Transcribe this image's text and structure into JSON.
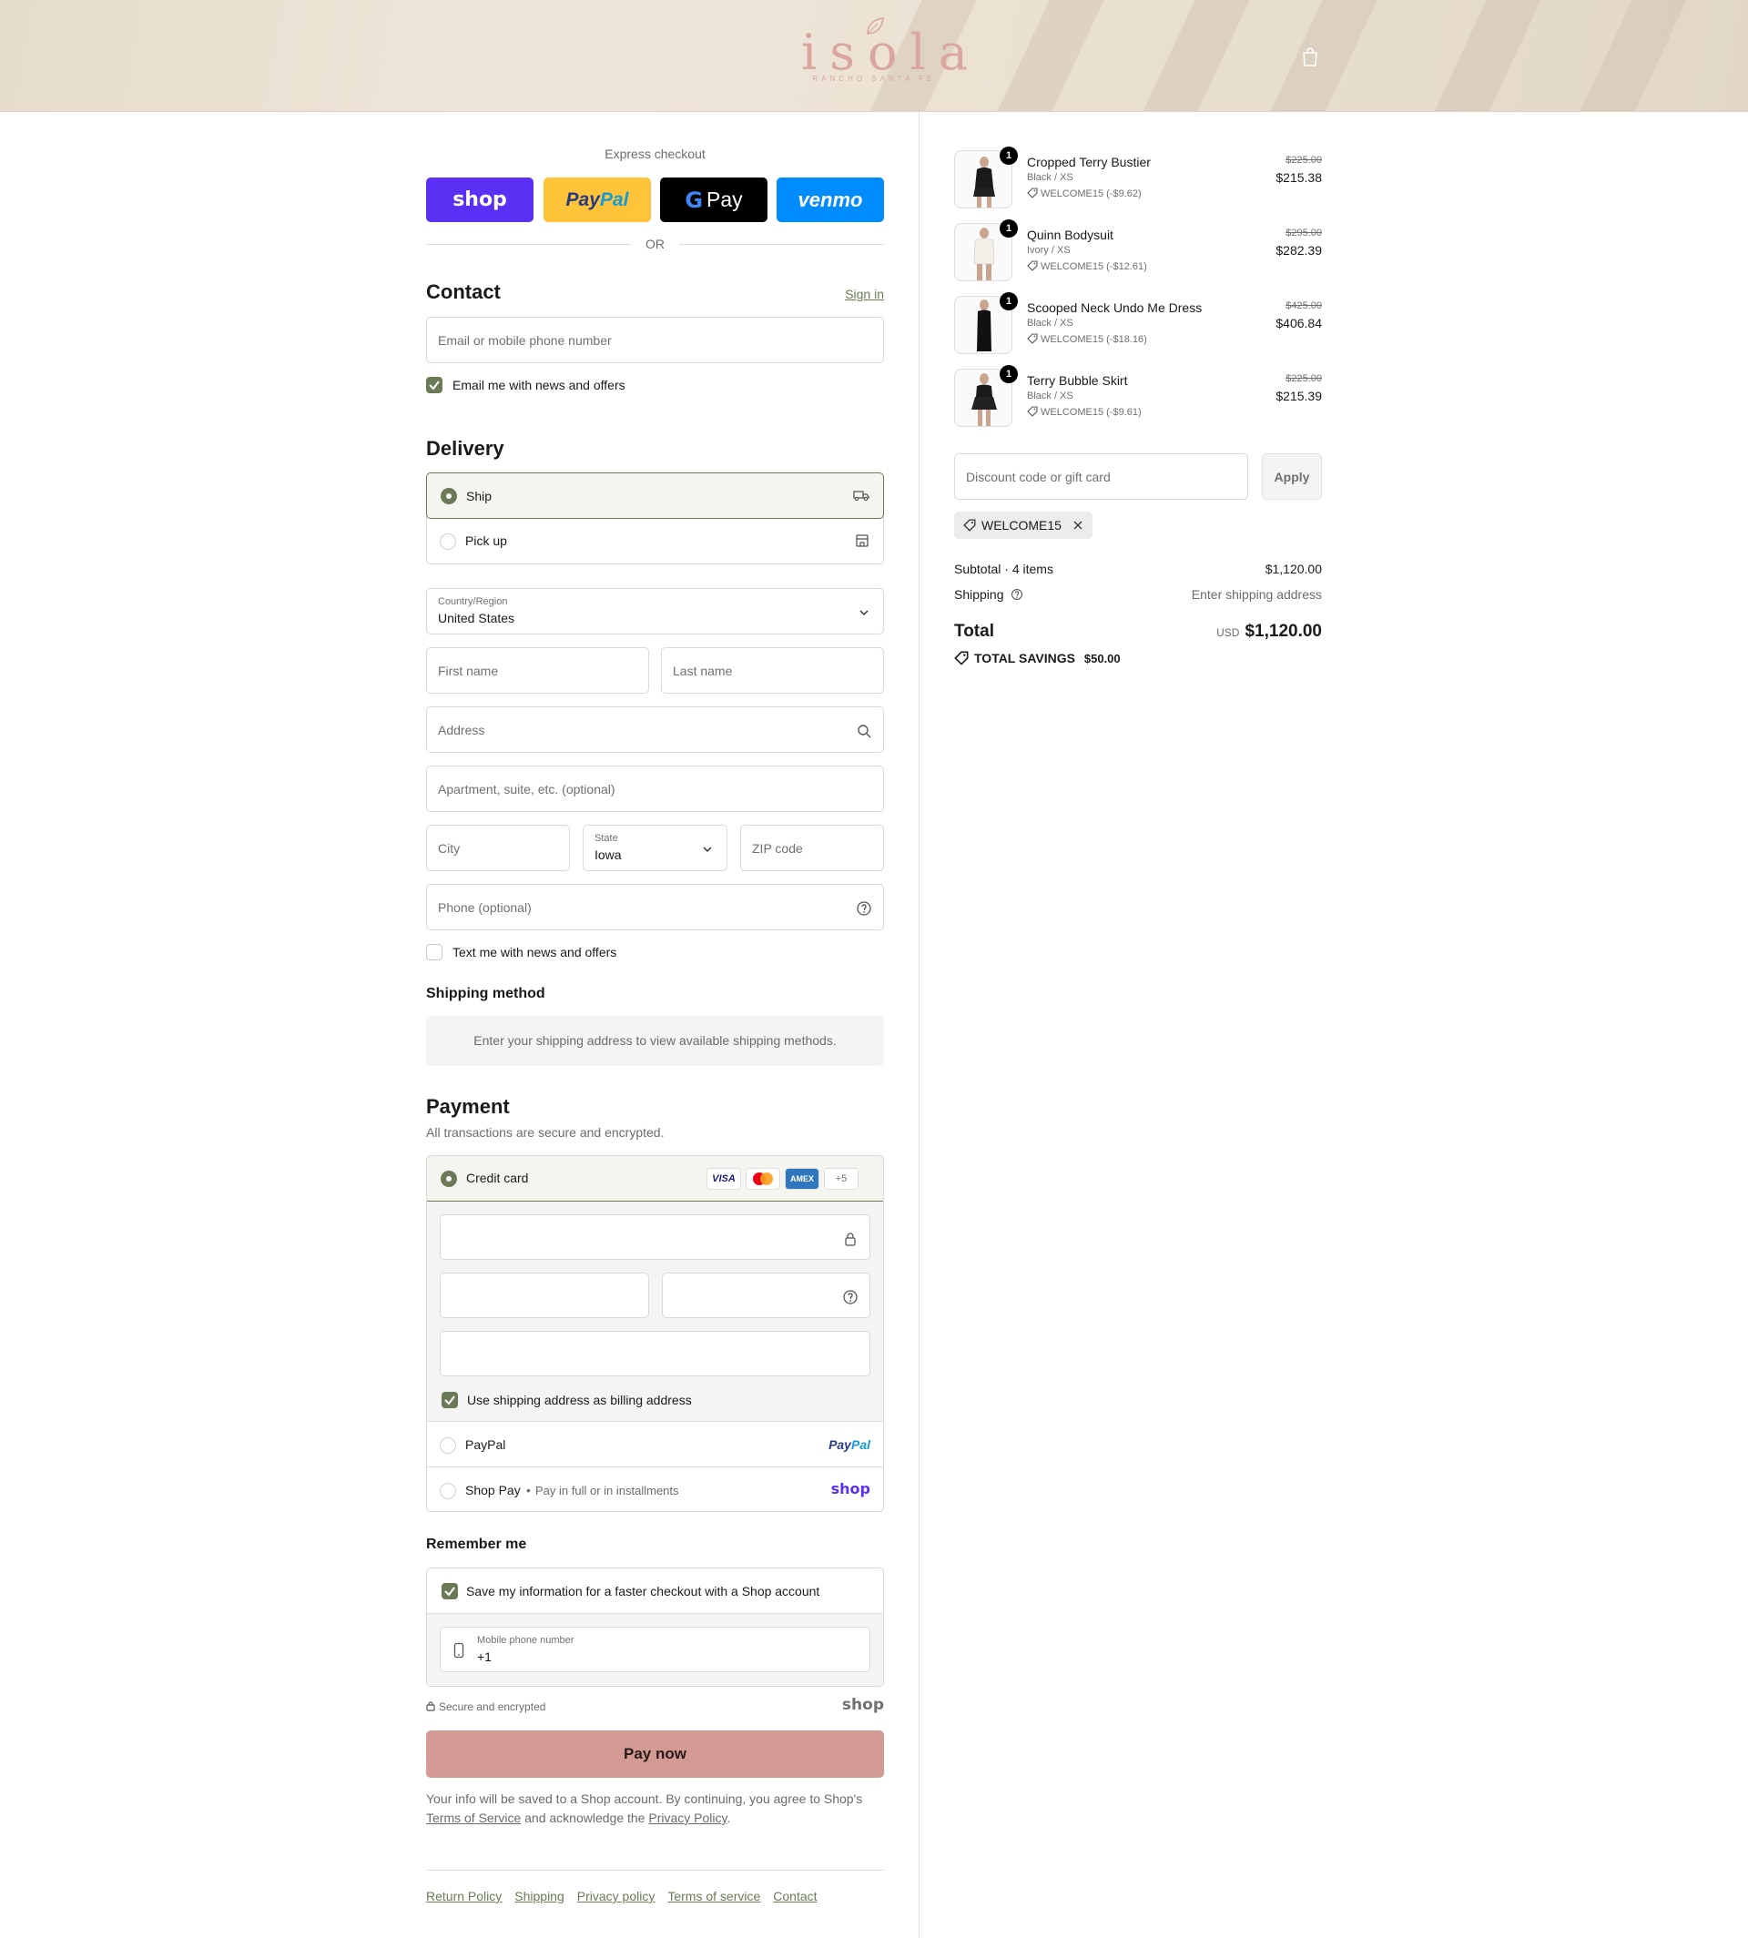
{
  "brand": {
    "logo_word": "isola",
    "logo_sub": "RANCHO SANTA FE"
  },
  "express": {
    "title": "Express checkout",
    "buttons": {
      "shop": "shop",
      "paypal_a": "Pay",
      "paypal_b": "Pal",
      "gpay_g": "G",
      "gpay_pay": "Pay",
      "venmo": "venmo"
    },
    "or": "OR"
  },
  "contact": {
    "heading": "Contact",
    "sign_in": "Sign in",
    "email_placeholder": "Email or mobile phone number",
    "newsletter_label": "Email me with news and offers",
    "newsletter_checked": true
  },
  "delivery": {
    "heading": "Delivery",
    "options": [
      {
        "label": "Ship",
        "selected": true,
        "icon": "truck-icon"
      },
      {
        "label": "Pick up",
        "selected": false,
        "icon": "store-icon"
      }
    ],
    "country_label": "Country/Region",
    "country_value": "United States",
    "first_name": "First name",
    "last_name": "Last name",
    "address": "Address",
    "apartment": "Apartment, suite, etc. (optional)",
    "city": "City",
    "state_label": "State",
    "state_value": "Iowa",
    "zip": "ZIP code",
    "phone": "Phone (optional)",
    "text_label": "Text me with news and offers",
    "text_checked": false
  },
  "shipping_method": {
    "heading": "Shipping method",
    "message": "Enter your shipping address to view available shipping methods."
  },
  "payment": {
    "heading": "Payment",
    "subtitle": "All transactions are secure and encrypted.",
    "credit_card_label": "Credit card",
    "card_badges": {
      "visa": "VISA",
      "amex": "AMEX",
      "more": "+5"
    },
    "billing_label": "Use shipping address as billing address",
    "billing_checked": true,
    "paypal_label": "PayPal",
    "paypal_logo_a": "Pay",
    "paypal_logo_b": "Pal",
    "shoppay_label": "Shop Pay",
    "shoppay_sub": "Pay in full or in installments",
    "shoppay_logo": "shop"
  },
  "remember": {
    "heading": "Remember me",
    "save_label": "Save my information for a faster checkout with a Shop account",
    "save_checked": true,
    "phone_label": "Mobile phone number",
    "phone_value": "+1"
  },
  "secure": {
    "text": "Secure and encrypted",
    "logo": "shop"
  },
  "pay_now": "Pay now",
  "terms": {
    "part1": "Your info will be saved to a Shop account. By continuing, you agree to Shop's ",
    "tos": "Terms of Service",
    "part2": " and acknowledge the ",
    "privacy": "Privacy Policy",
    "part3": "."
  },
  "footer_links": [
    "Return Policy",
    "Shipping",
    "Privacy policy",
    "Terms of service",
    "Contact"
  ],
  "cart": {
    "items": [
      {
        "name": "Cropped Terry Bustier",
        "variant": "Black / XS",
        "discount": "WELCOME15 (-$9.62)",
        "original": "$225.00",
        "price": "$215.38",
        "qty": "1"
      },
      {
        "name": "Quinn Bodysuit",
        "variant": "Ivory / XS",
        "discount": "WELCOME15 (-$12.61)",
        "original": "$295.00",
        "price": "$282.39",
        "qty": "1"
      },
      {
        "name": "Scooped Neck Undo Me Dress",
        "variant": "Black / XS",
        "discount": "WELCOME15 (-$18.16)",
        "original": "$425.00",
        "price": "$406.84",
        "qty": "1"
      },
      {
        "name": "Terry Bubble Skirt",
        "variant": "Black / XS",
        "discount": "WELCOME15 (-$9.61)",
        "original": "$225.00",
        "price": "$215.39",
        "qty": "1"
      }
    ],
    "discount_placeholder": "Discount code or gift card",
    "apply": "Apply",
    "applied_code": "WELCOME15",
    "subtotal_label": "Subtotal · 4 items",
    "subtotal_value": "$1,120.00",
    "shipping_label": "Shipping",
    "shipping_value": "Enter shipping address",
    "total_label": "Total",
    "currency": "USD",
    "total_value": "$1,120.00",
    "savings_label": "TOTAL SAVINGS",
    "savings_value": "$50.00"
  },
  "colors": {
    "accent": "#6b7a56",
    "pay_button": "#d39b94",
    "shop_purple": "#5a31f4",
    "paypal_yellow": "#ffc439",
    "venmo_blue": "#008cff"
  }
}
